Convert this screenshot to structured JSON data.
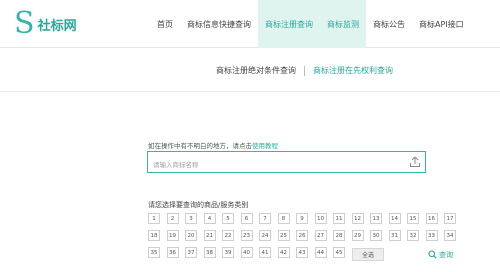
{
  "brand": {
    "logo_mark": "S",
    "name": "社标网"
  },
  "nav": {
    "items": [
      {
        "label": "首页"
      },
      {
        "label": "商标信息快捷查询"
      },
      {
        "label": "商标注册查询"
      },
      {
        "label": "商标监测"
      },
      {
        "label": "商标公告"
      },
      {
        "label": "商标API接口"
      }
    ],
    "active_indices": [
      2,
      3
    ]
  },
  "subnav": {
    "items": [
      {
        "label": "商标注册绝对条件查询"
      },
      {
        "label": "商标注册在先权利查询"
      }
    ],
    "active_index": 1
  },
  "search": {
    "hint_text": "如在操作中有不明白的地方，请点击",
    "hint_link": "使用教程",
    "placeholder": "请输入商标名称",
    "value": ""
  },
  "categories": {
    "title": "请您选择要查询的商品/服务类别",
    "rows": [
      [
        "1",
        "2",
        "3",
        "4",
        "5",
        "6",
        "7",
        "8",
        "9",
        "10",
        "11",
        "12",
        "13",
        "14",
        "15",
        "16",
        "17"
      ],
      [
        "18",
        "19",
        "20",
        "21",
        "22",
        "23",
        "24",
        "25",
        "26",
        "27",
        "28",
        "29",
        "30",
        "31",
        "32",
        "33",
        "34"
      ],
      [
        "35",
        "36",
        "37",
        "38",
        "39",
        "40",
        "41",
        "42",
        "43",
        "44",
        "45"
      ]
    ]
  },
  "actions": {
    "select_all_label": "全选",
    "search_label": "查询"
  },
  "colors": {
    "accent": "#2aa89a",
    "active_bg": "#dff3ef"
  }
}
